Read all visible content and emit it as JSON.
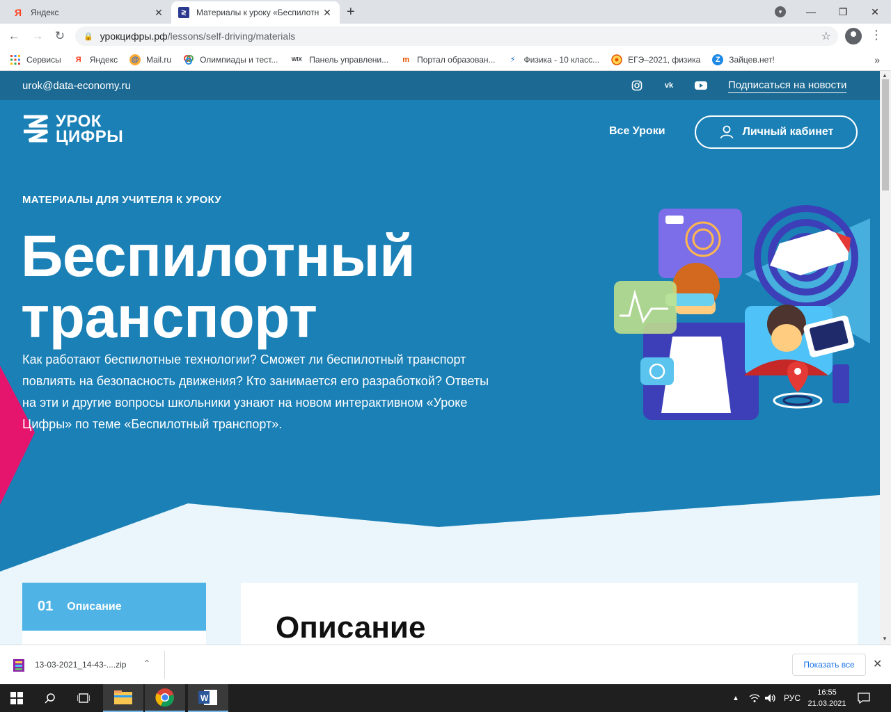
{
  "browser": {
    "tabs": [
      {
        "title": "Яндекс",
        "active": false
      },
      {
        "title": "Материалы к уроку «Беспилотн",
        "active": true
      }
    ],
    "url_host": "урокцифры.рф",
    "url_path": "/lessons/self-driving/materials",
    "bookmarks": [
      {
        "label": "Сервисы",
        "icon": "apps-grid-icon"
      },
      {
        "label": "Яндекс",
        "icon": "yandex-icon"
      },
      {
        "label": "Mail.ru",
        "icon": "mailru-icon"
      },
      {
        "label": "Олимпиады и тест...",
        "icon": "olympiad-icon"
      },
      {
        "label": "Панель управлени...",
        "icon": "wix-icon"
      },
      {
        "label": "Портал образован...",
        "icon": "portal-icon"
      },
      {
        "label": "Физика - 10 класс...",
        "icon": "physics-icon"
      },
      {
        "label": "ЕГЭ–2021, физика",
        "icon": "ege-icon"
      },
      {
        "label": "Зайцев.нет!",
        "icon": "zaitsev-icon"
      }
    ]
  },
  "site": {
    "email": "urok@data-economy.ru",
    "subscribe_label": "Подписаться на новости",
    "logo_line1": "УРОК",
    "logo_line2": "ЦИФРЫ",
    "nav_lessons": "Все Уроки",
    "cabinet_label": "Личный кабинет",
    "kicker": "МАТЕРИАЛЫ ДЛЯ УЧИТЕЛЯ К УРОКУ",
    "title_line1": "Беспилотный",
    "title_line2": "транспорт",
    "lead": "Как работают беспилотные технологии? Сможет ли беспилотный транспорт повлиять на безопасность движения? Кто занимается его разработкой? Ответы на эти и другие вопросы школьники узнают на новом интерактивном «Уроке Цифры» по теме «Беспилотный транспорт».",
    "side_tab_number": "01",
    "side_tab_label": "Описание",
    "section_title": "Описание",
    "colors": {
      "hero": "#1a80b6",
      "topbar": "#1c6a93",
      "accent": "#4fb3e6",
      "pink": "#e5156e"
    }
  },
  "downloads": {
    "file_name": "13-03-2021_14-43-....zip",
    "show_all": "Показать все"
  },
  "taskbar": {
    "lang": "РУС",
    "time": "16:55",
    "date": "21.03.2021"
  }
}
